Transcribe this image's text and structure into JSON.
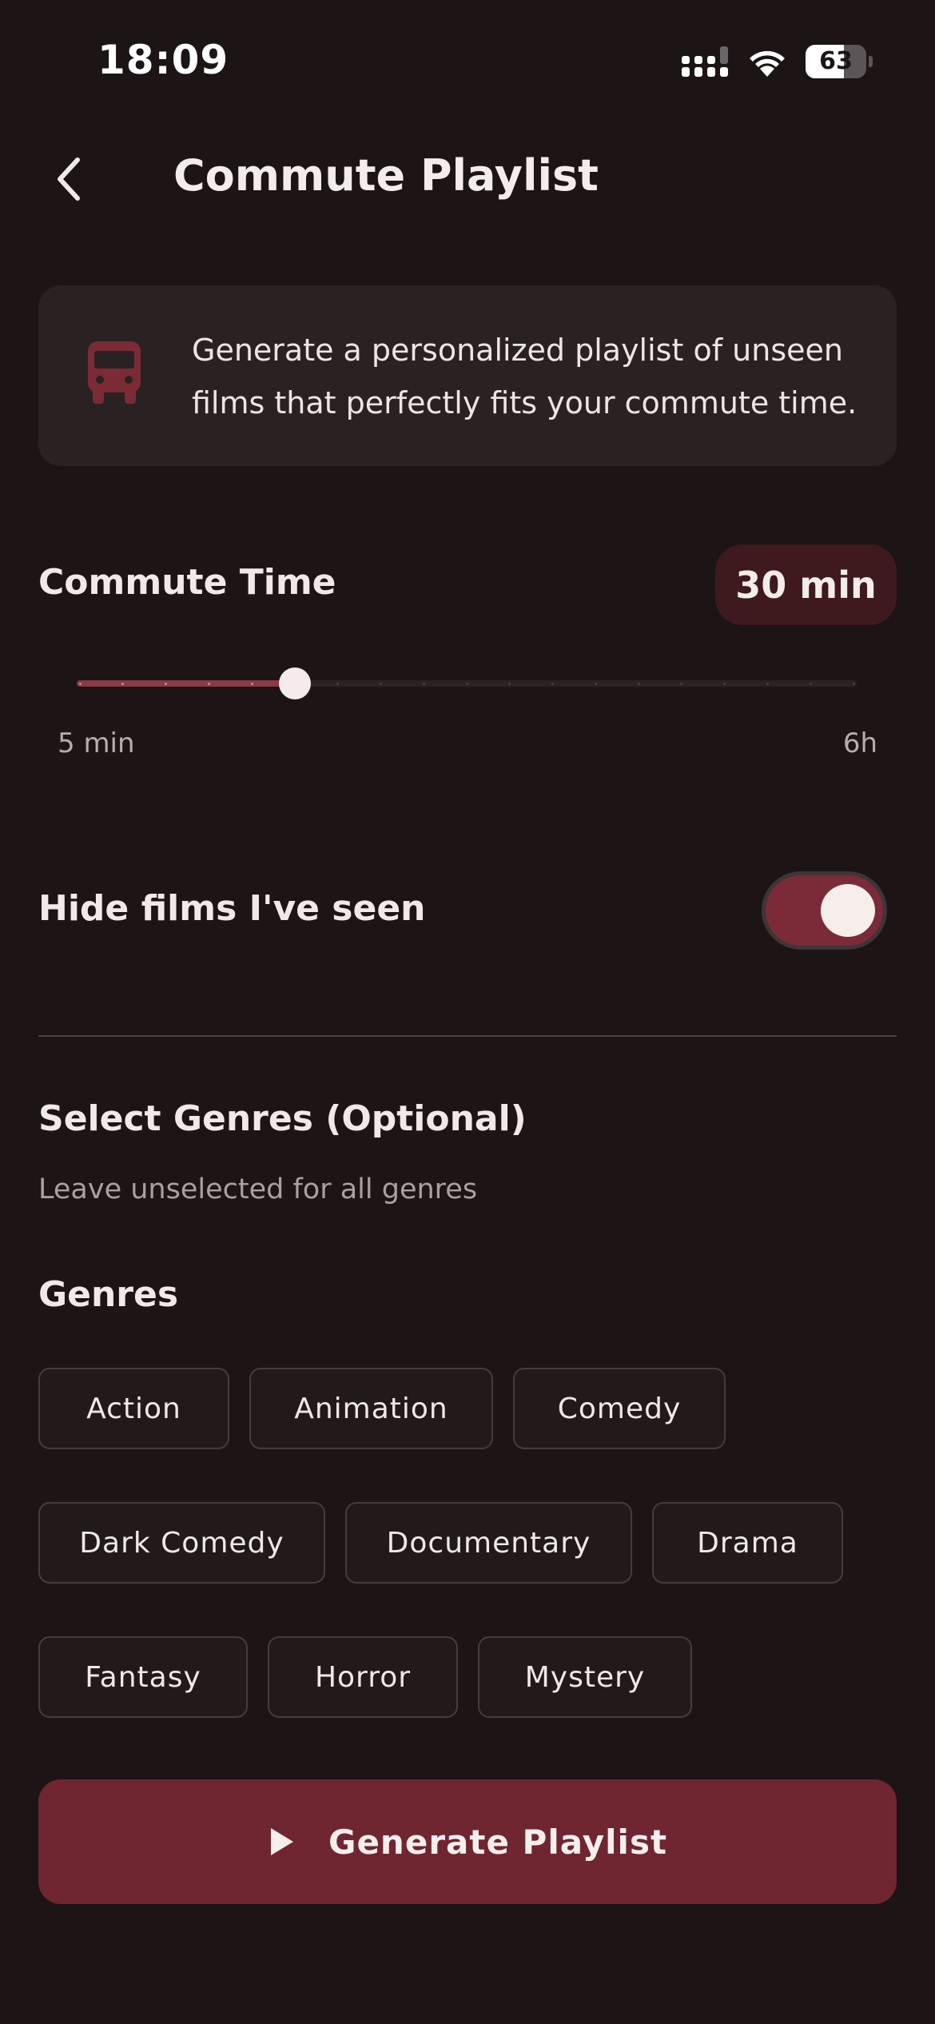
{
  "status_bar": {
    "time": "18:09",
    "battery": "63",
    "battery_level": 0.63,
    "icons": [
      "signal-icon",
      "wifi-icon",
      "battery-icon"
    ]
  },
  "header": {
    "back_icon": "chevron-left-icon",
    "title": "Commute Playlist"
  },
  "info_card": {
    "icon": "bus-icon",
    "text": "Generate a personalized playlist of unseen films that perfectly fits your commute time."
  },
  "commute": {
    "label": "Commute Time",
    "value": "30 min",
    "min_label": "5 min",
    "max_label": "6h",
    "slider_steps": 19,
    "slider_index": 5
  },
  "hide_seen": {
    "label": "Hide films I've seen",
    "enabled": true
  },
  "genres_section": {
    "title": "Select Genres (Optional)",
    "subtitle": "Leave unselected for all genres",
    "label": "Genres",
    "chips": [
      "Action",
      "Animation",
      "Comedy",
      "Dark Comedy",
      "Documentary",
      "Drama",
      "Fantasy",
      "Horror",
      "Mystery"
    ]
  },
  "generate_button": {
    "icon": "play-icon",
    "label": "Generate Playlist"
  },
  "colors": {
    "background": "#1c1415",
    "accent": "#6f2630",
    "card": "#2a2222",
    "badge": "#3e1a1e"
  }
}
